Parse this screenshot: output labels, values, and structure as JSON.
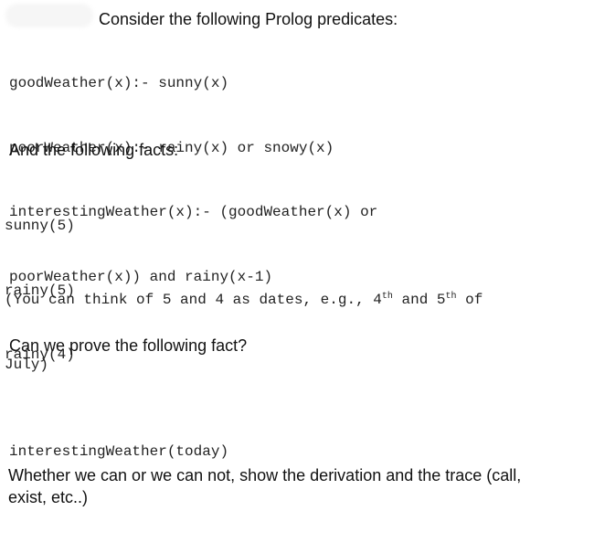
{
  "intro": {
    "heading": "Consider the following Prolog predicates:",
    "predicates": [
      "goodWeather(x):- sunny(x)",
      "poorWeather(x):- rainy(x) or snowy(x)",
      "interestingWeather(x):- (goodWeather(x) or",
      "poorWeather(x)) and rainy(x-1)"
    ]
  },
  "facts_section": {
    "heading": "And the following facts:",
    "facts": [
      "sunny(5)",
      "rainy(5)",
      "rainy(4)"
    ],
    "note": {
      "part1": "(You can think of 5 and 4 as dates, e.g., 4",
      "sup1": "th",
      "part2": " and 5",
      "sup2": "th",
      "part3": " of",
      "line2": "July)"
    }
  },
  "question": {
    "heading": "Can we prove the following fact?",
    "goal": "interestingWeather(today)",
    "instruction_line1": "Whether we can or we can not, show the derivation and the trace (call,",
    "instruction_line2": "exist, etc..)"
  }
}
